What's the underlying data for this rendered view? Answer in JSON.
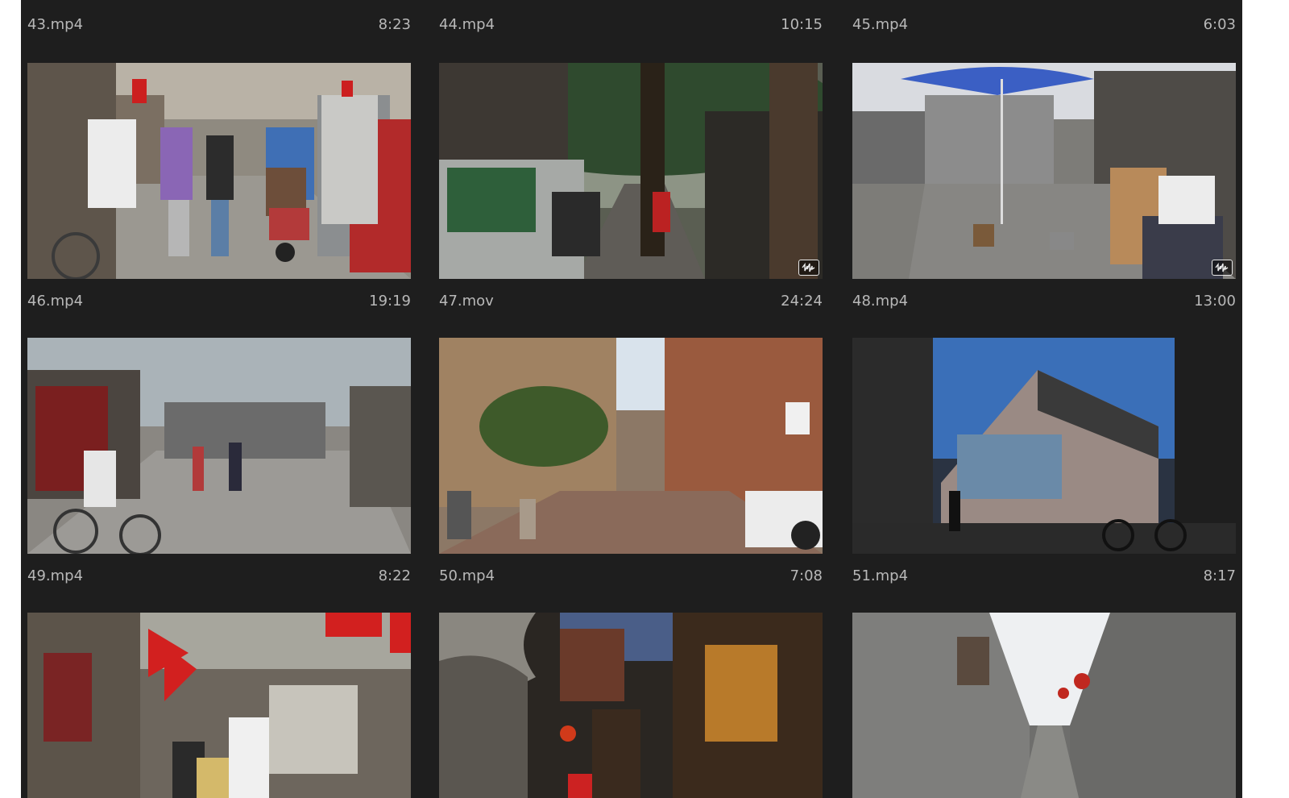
{
  "colors": {
    "panel_bg": "#1e1e1e",
    "label_text": "#b8b8b8",
    "badge_border": "#e8e8e8"
  },
  "clips": [
    {
      "name": "43.mp4",
      "duration": "8:23"
    },
    {
      "name": "44.mp4",
      "duration": "10:15"
    },
    {
      "name": "45.mp4",
      "duration": "6:03"
    },
    {
      "name": "46.mp4",
      "duration": "19:19"
    },
    {
      "name": "47.mov",
      "duration": "24:24",
      "badge_icon": "audio-waveform-icon"
    },
    {
      "name": "48.mp4",
      "duration": "13:00",
      "badge_icon": "audio-waveform-icon"
    },
    {
      "name": "49.mp4",
      "duration": "8:22"
    },
    {
      "name": "50.mp4",
      "duration": "7:08"
    },
    {
      "name": "51.mp4",
      "duration": "8:17"
    },
    {
      "name": "",
      "duration": ""
    },
    {
      "name": "",
      "duration": ""
    },
    {
      "name": "",
      "duration": ""
    }
  ]
}
